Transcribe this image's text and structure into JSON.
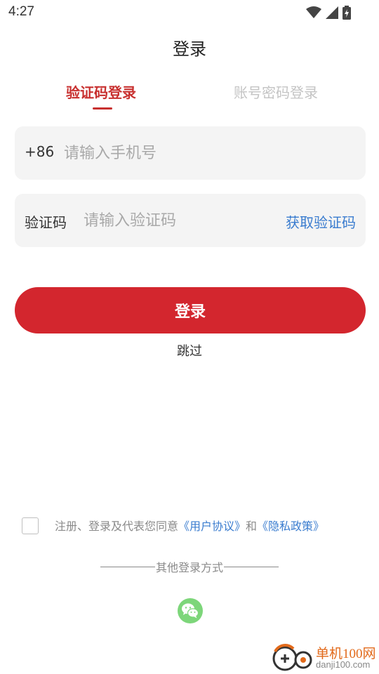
{
  "status_bar": {
    "time": "4:27"
  },
  "page_title": "登录",
  "tabs": [
    {
      "label": "验证码登录",
      "active": true
    },
    {
      "label": "账号密码登录",
      "active": false
    }
  ],
  "phone_field": {
    "prefix": "+86",
    "placeholder": "请输入手机号",
    "value": ""
  },
  "code_field": {
    "prefix": "验证码",
    "placeholder": "请输入验证码",
    "value": "",
    "get_code_label": "获取验证码"
  },
  "login_button": "登录",
  "skip_label": "跳过",
  "agreement": {
    "checked": false,
    "prefix_text": "注册、登录及代表您同意",
    "user_agreement": "《用户协议》",
    "and_text": "和",
    "privacy_policy": "《隐私政策》"
  },
  "other_login": {
    "label": "其他登录方式",
    "icons": [
      "wechat-icon"
    ]
  },
  "watermark": {
    "text": "单机100网",
    "sub": "danji100.com"
  },
  "colors": {
    "accent": "#c8302f",
    "button": "#d3262e",
    "link": "#3a7ccf",
    "wechat": "#7dd67a"
  }
}
